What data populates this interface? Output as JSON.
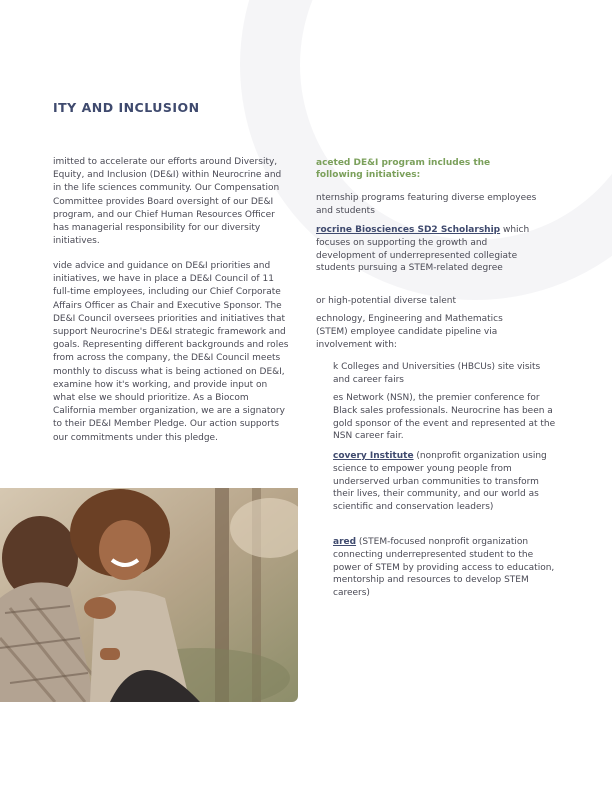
{
  "section": {
    "heading": "ITY AND INCLUSION",
    "paragraph_1": "imitted to accelerate our efforts around Diversity, Equity, and Inclusion (DE&I) within Neurocrine and in the life sciences community. Our Compensation Committee provides Board oversight of our DE&I program, and our Chief Human Resources Officer has managerial responsibility for our diversity initiatives.",
    "paragraph_2": "vide advice and guidance on DE&I priorities and initiatives, we have in place a DE&I Council of 11 full-time employees, including our Chief Corporate Affairs Officer as Chair and Executive Sponsor. The DE&I Council oversees priorities and initiatives that support Neurocrine's DE&I strategic framework and goals. Representing different backgrounds and roles from across the company, the DE&I Council meets monthly to discuss what is being actioned on DE&I, examine how it's working, and provide input on what else we should prioritize. As a Biocom California member organization, we are a signatory to their DE&I Member Pledge. Our action supports our commitments under this pledge."
  },
  "initiatives": {
    "intro": "aceted DE&I program includes the following initiatives:",
    "items": [
      {
        "link": "",
        "text": "nternship programs featuring diverse employees and students"
      },
      {
        "link": "rocrine Biosciences SD2 Scholarship",
        "text": " which focuses on supporting the growth and development of underrepresented collegiate students pursuing a STEM-related degree"
      },
      {
        "link": "",
        "text": "or high-potential diverse talent"
      },
      {
        "link": "",
        "text": "echnology, Engineering and Mathematics (STEM) employee candidate pipeline via involvement with:"
      },
      {
        "link": "",
        "text": "k Colleges and Universities (HBCUs) site visits and career fairs"
      },
      {
        "link": "",
        "text": "es Network (NSN), the premier conference for Black sales professionals. Neurocrine has been a gold sponsor of the event and represented at the NSN career fair."
      },
      {
        "link": "covery Institute",
        "text": " (nonprofit organization using science to empower young people from underserved urban communities to transform their lives, their community, and our world as scientific and conservation leaders)"
      },
      {
        "link": "ared",
        "text": " (STEM-focused nonprofit organization connecting underrepresented student to the power of STEM by providing access to education, mentorship and resources to develop STEM careers)"
      }
    ]
  },
  "footer": {
    "left": "",
    "middle": "",
    "right": ""
  },
  "colors": {
    "heading": "#3f4a6e",
    "body_text": "#4a4a55",
    "accent_green": "#7ba05b",
    "photo_coat_plaid": "#b3a392",
    "photo_background": "#b7a58a"
  }
}
